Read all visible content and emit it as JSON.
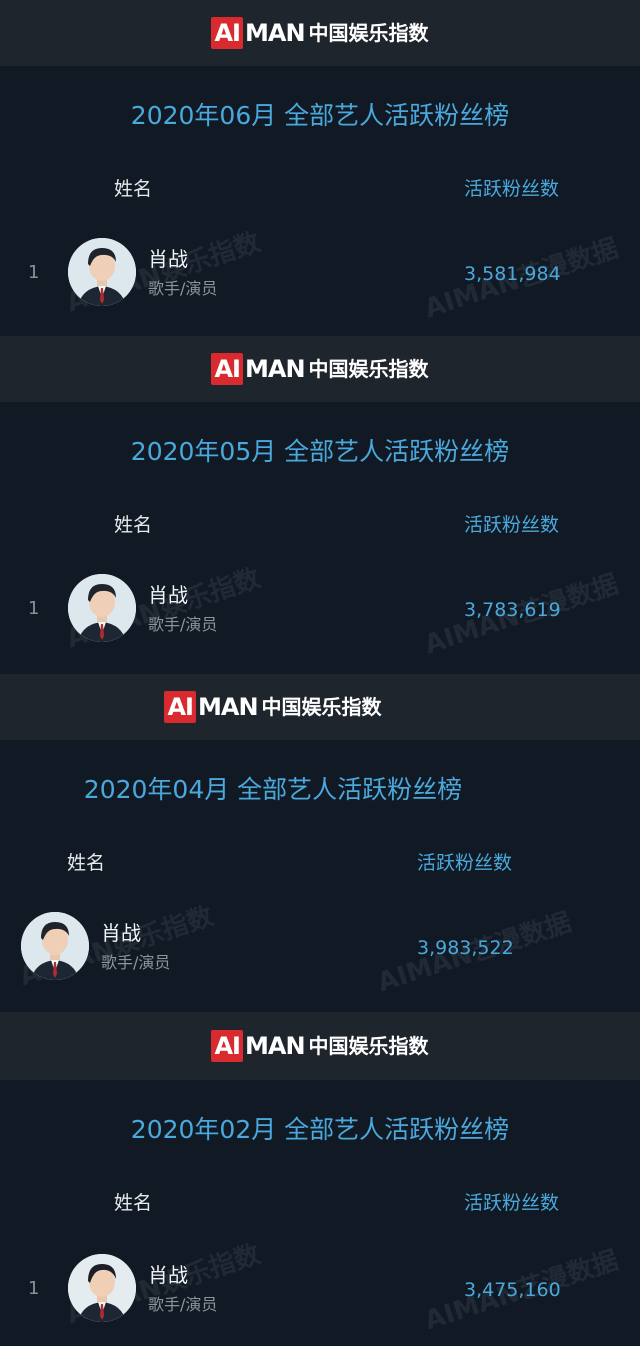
{
  "brand": {
    "ai": "AI",
    "man": "MAN",
    "cn": "中国娱乐指数"
  },
  "watermark": {
    "text1": "AIMAN娱乐指数",
    "text2": "AIMAN艺漫数据"
  },
  "colors": {
    "accent": "#4aa8dc",
    "logo_red": "#d82a2f",
    "header_bg": "#1f252c",
    "panel_bg": "#111a24"
  },
  "panels": [
    {
      "title": "2020年06月 全部艺人活跃粉丝榜",
      "col_name": "姓名",
      "col_fans": "活跃粉丝数",
      "row": {
        "rank": "1",
        "name": "肖战",
        "role": "歌手/演员",
        "fans": "3,581,984",
        "avatar": "avatar-photo"
      }
    },
    {
      "title": "2020年05月 全部艺人活跃粉丝榜",
      "col_name": "姓名",
      "col_fans": "活跃粉丝数",
      "row": {
        "rank": "1",
        "name": "肖战",
        "role": "歌手/演员",
        "fans": "3,783,619",
        "avatar": "avatar-photo"
      }
    },
    {
      "title": "2020年04月 全部艺人活跃粉丝榜",
      "col_name": "姓名",
      "col_fans": "活跃粉丝数",
      "row": {
        "rank": "",
        "name": "肖战",
        "role": "歌手/演员",
        "fans": "3,983,522",
        "avatar": "avatar-photo"
      }
    },
    {
      "title": "2020年02月 全部艺人活跃粉丝榜",
      "col_name": "姓名",
      "col_fans": "活跃粉丝数",
      "row": {
        "rank": "1",
        "name": "肖战",
        "role": "歌手/演员",
        "fans": "3,475,160",
        "avatar": "avatar-photo"
      }
    }
  ]
}
